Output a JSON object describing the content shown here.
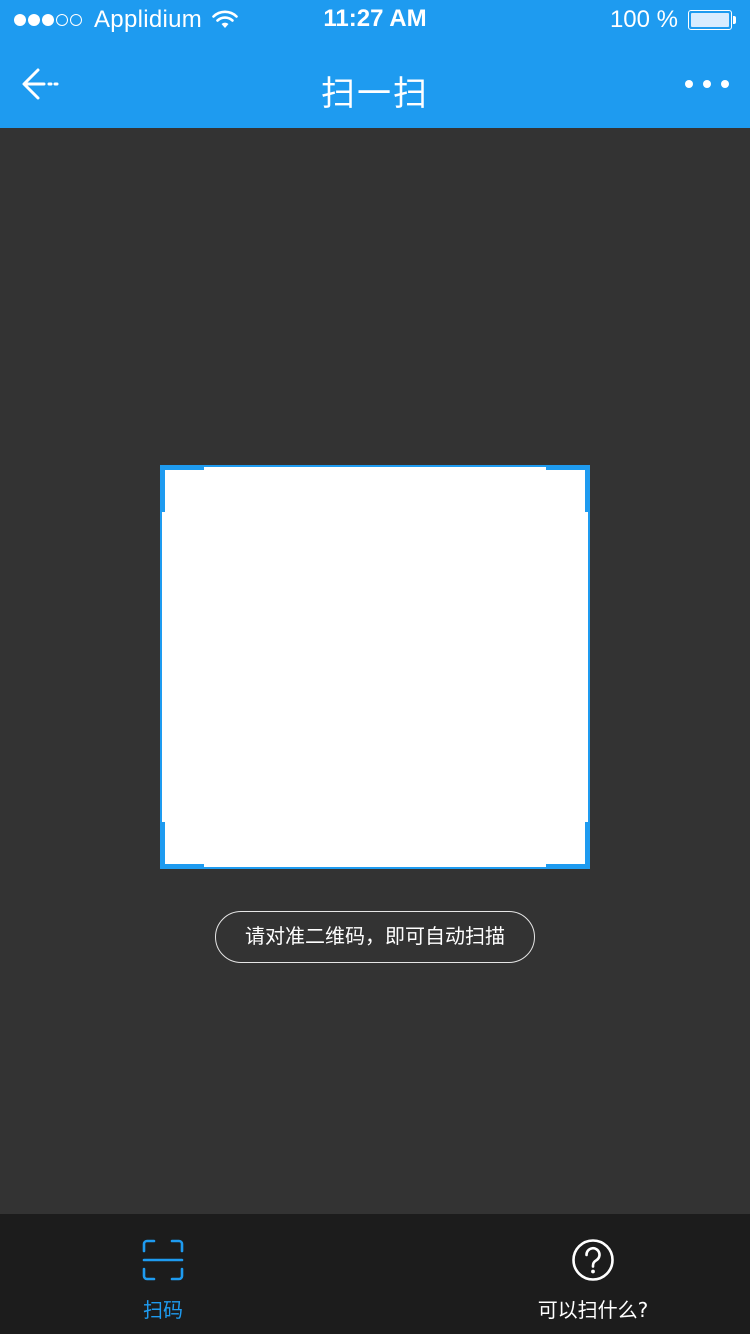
{
  "status_bar": {
    "carrier": "Applidium",
    "time": "11:27 AM",
    "battery": "100 %",
    "signal_bars_filled": 3,
    "signal_bars_total": 5,
    "battery_level": 1.0
  },
  "nav": {
    "title": "扫一扫",
    "back_icon": "back-arrow-icon",
    "more_icon": "more-dots-icon"
  },
  "scanner": {
    "hint": "请对准二维码，即可自动扫描",
    "frame_color": "#1e9bf0"
  },
  "tabs": [
    {
      "label": "扫码",
      "icon": "scan-code-icon",
      "active": true
    },
    {
      "label": "可以扫什么?",
      "icon": "question-circle-icon",
      "active": false
    }
  ],
  "colors": {
    "accent": "#1e9bf0",
    "background": "#333333",
    "tab_bar": "#1c1c1c"
  }
}
